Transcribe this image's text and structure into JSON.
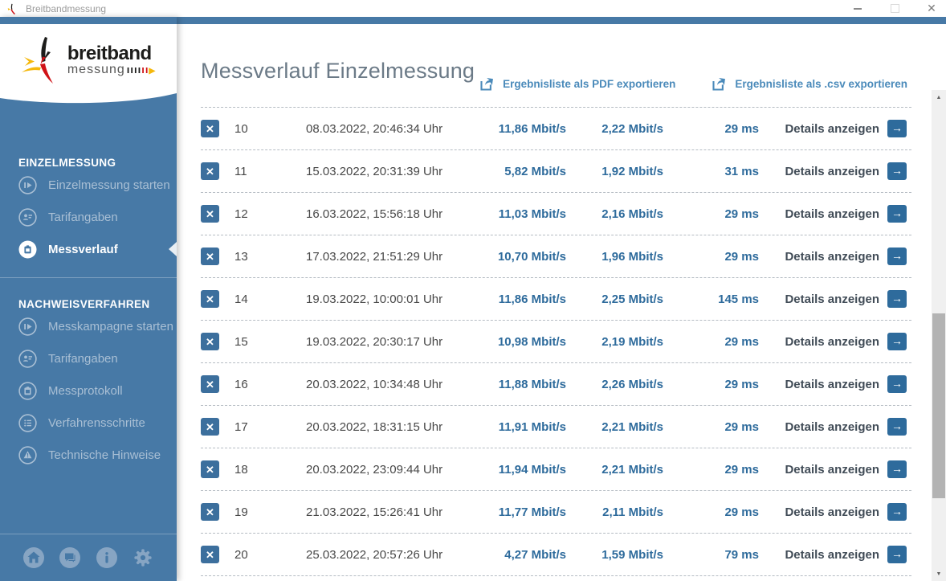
{
  "window": {
    "title": "Breitbandmessung",
    "controls": {
      "minimize": "minimize",
      "maximize": "maximize",
      "close": "✕"
    }
  },
  "logo": {
    "line1": "breitband",
    "line2": "messung",
    "marks1": "ıııı",
    "marks2": "ıı",
    "marks3": "▶"
  },
  "sidebar": {
    "sections": [
      {
        "header": "EINZELMESSUNG",
        "items": [
          {
            "label": "Einzelmessung starten",
            "icon": "play-circle-icon",
            "active": false
          },
          {
            "label": "Tarifangaben",
            "icon": "person-circle-icon",
            "active": false
          },
          {
            "label": "Messverlauf",
            "icon": "clipboard-circle-icon",
            "active": true
          }
        ]
      },
      {
        "header": "NACHWEISVERFAHREN",
        "items": [
          {
            "label": "Messkampagne starten",
            "icon": "play-circle-icon",
            "active": false
          },
          {
            "label": "Tarifangaben",
            "icon": "person-circle-icon",
            "active": false
          },
          {
            "label": "Messprotokoll",
            "icon": "clipboard-circle-icon",
            "active": false
          },
          {
            "label": "Verfahrensschritte",
            "icon": "list-circle-icon",
            "active": false
          },
          {
            "label": "Technische Hinweise",
            "icon": "warning-circle-icon",
            "active": false
          }
        ]
      }
    ],
    "footer_icons": [
      "home-icon",
      "chat-icon",
      "info-icon",
      "gear-icon"
    ]
  },
  "main": {
    "title": "Messverlauf Einzelmessung",
    "export_pdf_label": "Ergebnisliste als PDF exportieren",
    "export_csv_label": "Ergebnisliste als .csv exportieren",
    "details_label": "Details anzeigen",
    "delete_label": "✕",
    "arrow_label": "→",
    "rows": [
      {
        "index": "10",
        "datetime": "08.03.2022, 20:46:34 Uhr",
        "download": "11,86 Mbit/s",
        "upload": "2,22 Mbit/s",
        "ping": "29 ms"
      },
      {
        "index": "11",
        "datetime": "15.03.2022, 20:31:39 Uhr",
        "download": "5,82 Mbit/s",
        "upload": "1,92 Mbit/s",
        "ping": "31 ms"
      },
      {
        "index": "12",
        "datetime": "16.03.2022, 15:56:18 Uhr",
        "download": "11,03 Mbit/s",
        "upload": "2,16 Mbit/s",
        "ping": "29 ms"
      },
      {
        "index": "13",
        "datetime": "17.03.2022, 21:51:29 Uhr",
        "download": "10,70 Mbit/s",
        "upload": "1,96 Mbit/s",
        "ping": "29 ms"
      },
      {
        "index": "14",
        "datetime": "19.03.2022, 10:00:01 Uhr",
        "download": "11,86 Mbit/s",
        "upload": "2,25 Mbit/s",
        "ping": "145 ms"
      },
      {
        "index": "15",
        "datetime": "19.03.2022, 20:30:17 Uhr",
        "download": "10,98 Mbit/s",
        "upload": "2,19 Mbit/s",
        "ping": "29 ms"
      },
      {
        "index": "16",
        "datetime": "20.03.2022, 10:34:48 Uhr",
        "download": "11,88 Mbit/s",
        "upload": "2,26 Mbit/s",
        "ping": "29 ms"
      },
      {
        "index": "17",
        "datetime": "20.03.2022, 18:31:15 Uhr",
        "download": "11,91 Mbit/s",
        "upload": "2,21 Mbit/s",
        "ping": "29 ms"
      },
      {
        "index": "18",
        "datetime": "20.03.2022, 23:09:44 Uhr",
        "download": "11,94 Mbit/s",
        "upload": "2,21 Mbit/s",
        "ping": "29 ms"
      },
      {
        "index": "19",
        "datetime": "21.03.2022, 15:26:41 Uhr",
        "download": "11,77 Mbit/s",
        "upload": "2,11 Mbit/s",
        "ping": "29 ms"
      },
      {
        "index": "20",
        "datetime": "25.03.2022, 20:57:26 Uhr",
        "download": "4,27 Mbit/s",
        "upload": "1,59 Mbit/s",
        "ping": "79 ms"
      }
    ]
  },
  "colors": {
    "sidebar_blue": "#4779a6",
    "accent_blue": "#2e6b9c",
    "link_blue": "#4a8aba",
    "inactive_item": "#a9bfd4",
    "text_dark": "#474747",
    "details_text": "#414c57",
    "logo_black": "#1d1d1b",
    "logo_red": "#d01217",
    "logo_gold": "#f5b80c"
  }
}
